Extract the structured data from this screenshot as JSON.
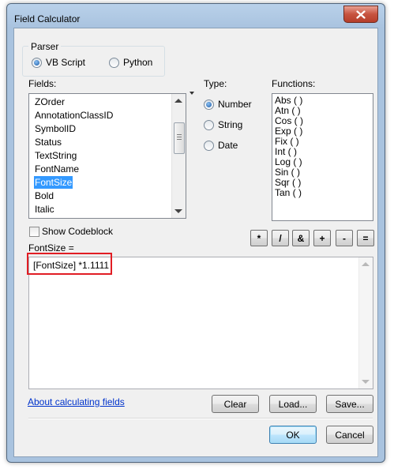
{
  "window": {
    "title": "Field Calculator"
  },
  "parser": {
    "legend": "Parser",
    "options": [
      {
        "label": "VB Script",
        "selected": true
      },
      {
        "label": "Python",
        "selected": false
      }
    ]
  },
  "fields": {
    "label": "Fields:",
    "items": [
      "ZOrder",
      "AnnotationClassID",
      "SymbolID",
      "Status",
      "TextString",
      "FontName",
      "FontSize",
      "Bold",
      "Italic"
    ],
    "selected": "FontSize"
  },
  "type": {
    "label": "Type:",
    "options": [
      {
        "label": "Number",
        "selected": true
      },
      {
        "label": "String",
        "selected": false
      },
      {
        "label": "Date",
        "selected": false
      }
    ]
  },
  "functions": {
    "label": "Functions:",
    "items": [
      "Abs ( )",
      "Atn ( )",
      "Cos ( )",
      "Exp ( )",
      "Fix ( )",
      "Int ( )",
      "Log ( )",
      "Sin ( )",
      "Sqr ( )",
      "Tan ( )"
    ]
  },
  "show_codeblock": {
    "label": "Show Codeblock",
    "checked": false
  },
  "operators": [
    "*",
    "/",
    "&",
    "+",
    "-",
    "="
  ],
  "expression": {
    "label": "FontSize =",
    "value": "[FontSize] *1.1111"
  },
  "help_link": "About calculating fields",
  "buttons": {
    "clear": "Clear",
    "load": "Load...",
    "save": "Save...",
    "ok": "OK",
    "cancel": "Cancel"
  },
  "colors": {
    "selection": "#3399ff",
    "highlight_box": "#e11d24",
    "link": "#0033cc"
  }
}
